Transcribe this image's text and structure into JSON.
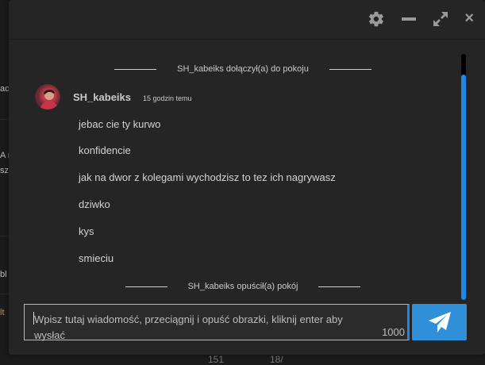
{
  "background": {
    "fragments": [
      "ac",
      "A r",
      "sz",
      "bl",
      "lt"
    ],
    "bottom": [
      "151",
      "18/"
    ]
  },
  "header": {
    "icons": [
      "gear-icon",
      "minimize-icon",
      "expand-icon",
      "close-icon"
    ],
    "close_symbol": "×"
  },
  "system_messages": {
    "joined": "SH_kabeiks dołączył(a) do pokoju",
    "left": "SH_kabeiks opuścił(a) pokój"
  },
  "message": {
    "author": "SH_kabeiks",
    "time": "15 godzin temu",
    "lines": [
      "jebac cie ty kurwo",
      "konfidencie",
      "jak na dwor z kolegami wychodzisz to tez ich nagrywasz",
      "dziwko",
      "kys",
      "smieciu"
    ]
  },
  "composer": {
    "placeholder": "Wpisz tutaj wiadomość, przeciągnij i opuść obrazki, kliknij enter aby wysłać",
    "char_count": "1000"
  },
  "colors": {
    "accent": "#1e88e5",
    "send_button": "#2f8fd8",
    "window_bg": "#252525"
  }
}
